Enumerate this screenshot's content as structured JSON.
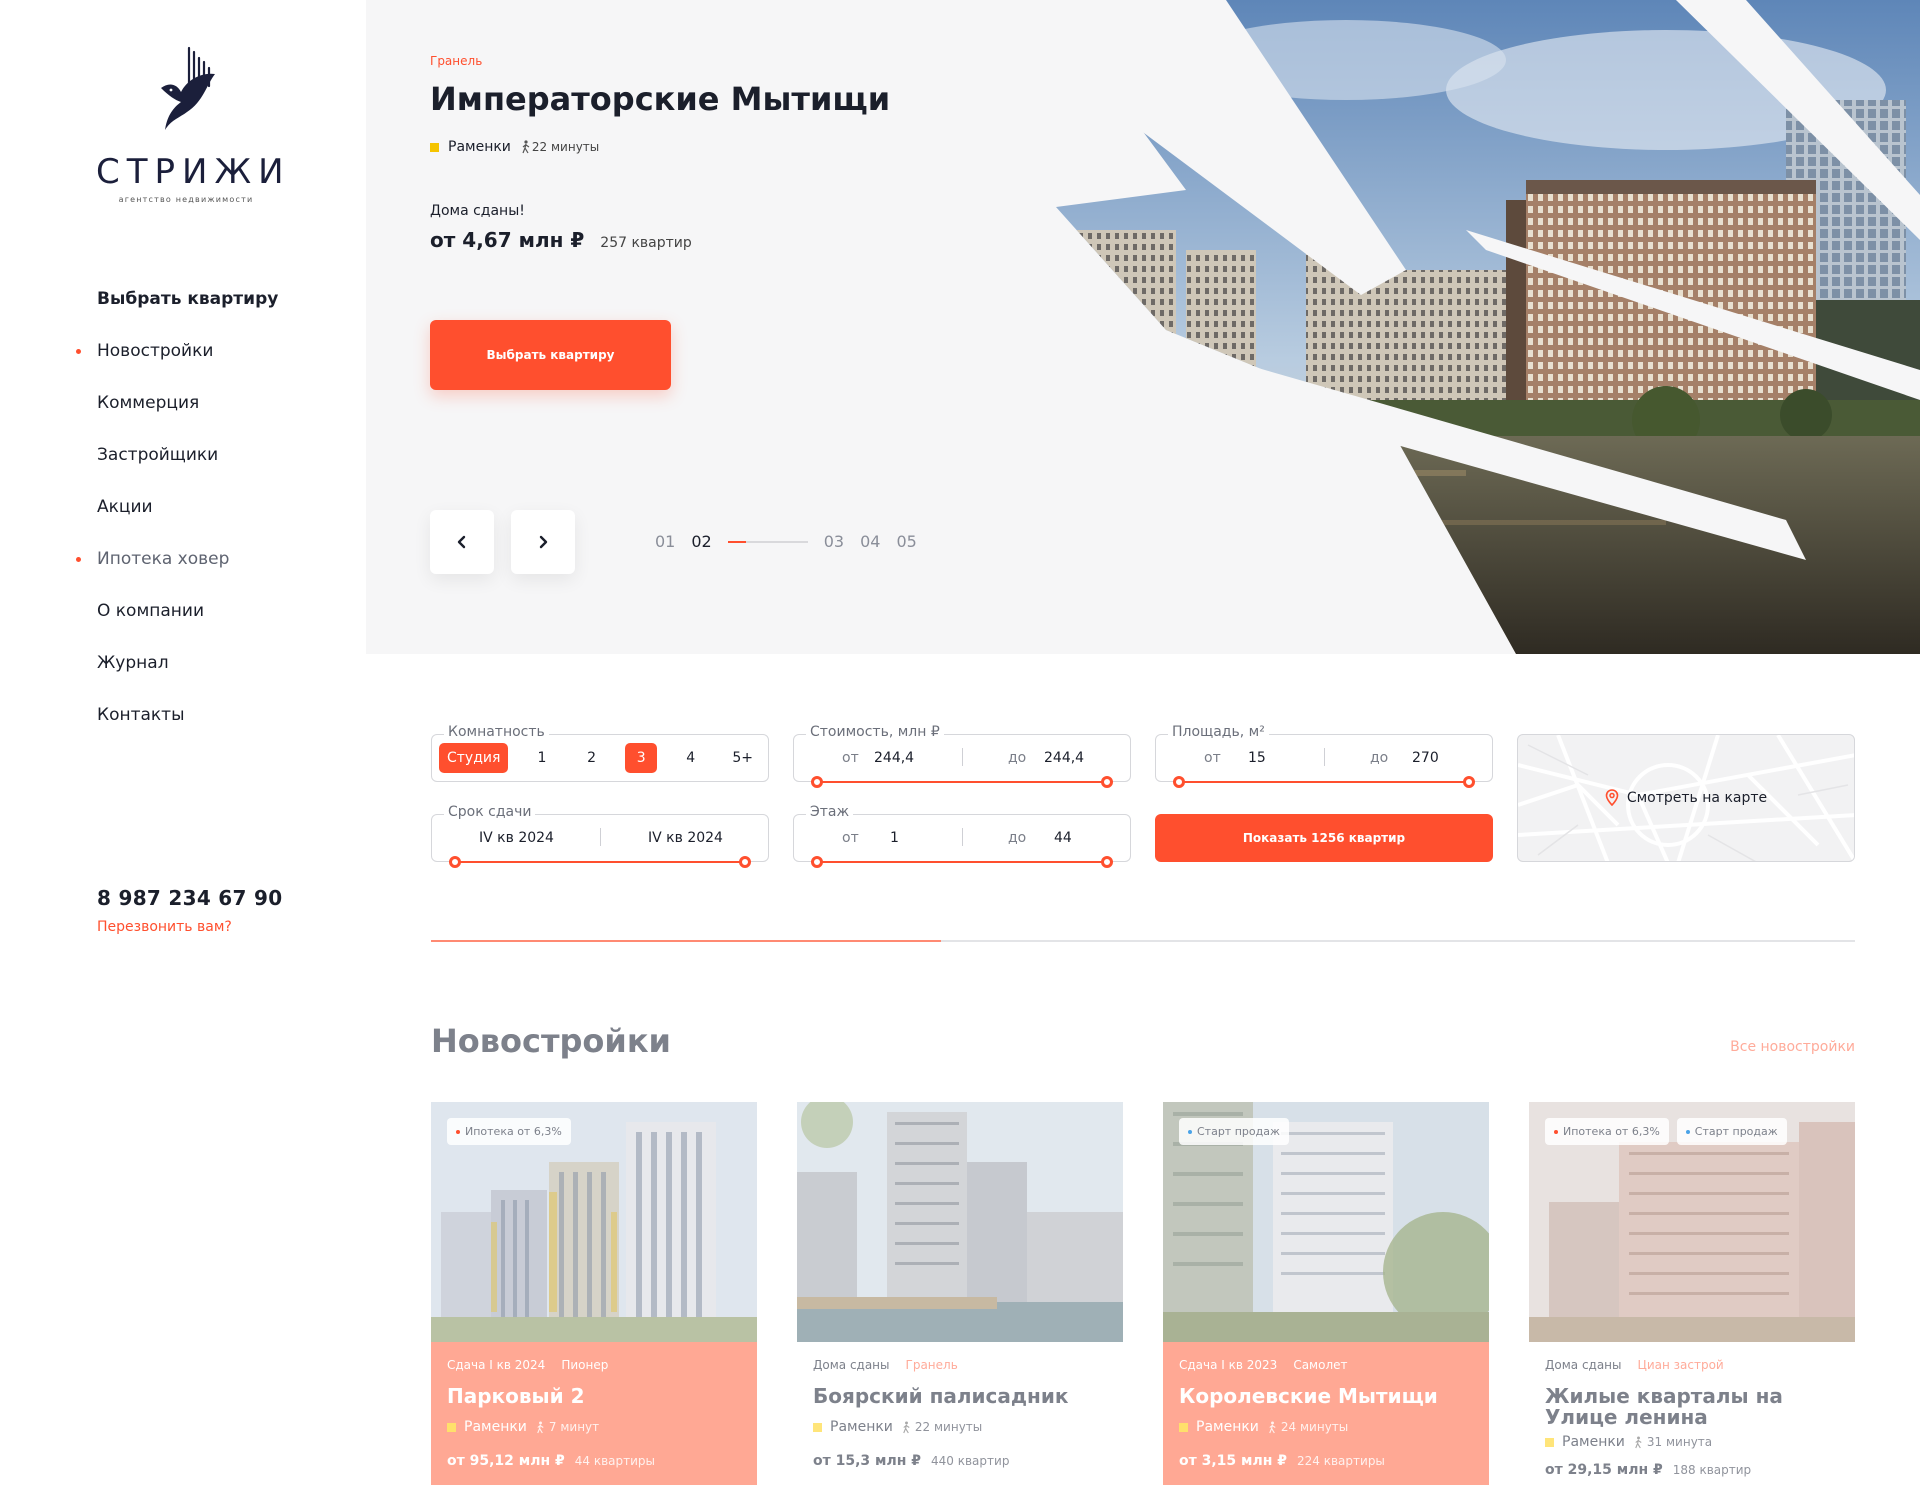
{
  "brand": {
    "name": "СТРИЖИ",
    "tagline": "агентство недвижимости"
  },
  "nav": [
    {
      "label": "Выбрать квартиру",
      "dot": false
    },
    {
      "label": "Новостройки",
      "dot": true
    },
    {
      "label": "Коммерция",
      "dot": false
    },
    {
      "label": "Застройщики",
      "dot": false
    },
    {
      "label": "Акции",
      "dot": false
    },
    {
      "label": "Ипотека ховер",
      "dot": true
    },
    {
      "label": "О компании",
      "dot": false
    },
    {
      "label": "Журнал",
      "dot": false
    },
    {
      "label": "Контакты",
      "dot": false
    }
  ],
  "contact": {
    "phone": "8 987 234 67 90",
    "callback": "Перезвонить вам?"
  },
  "hero": {
    "developer": "Гранель",
    "title": "Императорские Мытищи",
    "metro": "Раменки",
    "walk": "22 минуты",
    "status": "Дома сданы!",
    "price": "от 4,67 млн ₽",
    "count": "257 квартир",
    "cta": "Выбрать квартиру",
    "pager": {
      "p1": "01",
      "p2": "02",
      "p3": "03",
      "p4": "04",
      "p5": "05",
      "active": "02"
    }
  },
  "filters": {
    "rooms": {
      "label": "Комнатность",
      "options": [
        "Студия",
        "1",
        "2",
        "3",
        "4",
        "5+"
      ],
      "selected": [
        "Студия",
        "3"
      ]
    },
    "cost": {
      "label": "Стоимость, млн ₽",
      "from_label": "от",
      "from": "244,4",
      "to_label": "до",
      "to": "244,4"
    },
    "area": {
      "label": "Площадь, м²",
      "from_label": "от",
      "from": "15",
      "to_label": "до",
      "to": "270"
    },
    "deadline": {
      "label": "Срок сдачи",
      "from": "IV кв 2024",
      "to": "IV кв 2024"
    },
    "floor": {
      "label": "Этаж",
      "from_label": "от",
      "from": "1",
      "to_label": "до",
      "to": "44"
    },
    "show_button": "Показать 1256 квартир",
    "map_button": "Смотреть на карте"
  },
  "section": {
    "title": "Новостройки",
    "all_link": "Все новостройки",
    "cards": [
      {
        "badges": [
          "Ипотека от 6,3%"
        ],
        "deadline": "Сдача I кв 2024",
        "developer": "Пионер",
        "name": "Парковый 2",
        "metro": "Раменки",
        "walk": "7 минут",
        "price": "от 95,12 млн ₽",
        "count": "44 квартиры"
      },
      {
        "badges": [],
        "deadline": "Дома сданы",
        "developer": "Гранель",
        "name": "Боярский палисадник",
        "metro": "Раменки",
        "walk": "22 минуты",
        "price": "от 15,3 млн ₽",
        "count": "440 квартир"
      },
      {
        "badges": [
          "Старт продаж"
        ],
        "deadline": "Сдача I кв 2023",
        "developer": "Самолет",
        "name": "Королевские Мытищи",
        "metro": "Раменки",
        "walk": "24 минуты",
        "price": "от 3,15 млн ₽",
        "count": "224 квартиры"
      },
      {
        "badges": [
          "Ипотека от 6,3%",
          "Старт продаж"
        ],
        "deadline": "Дома сданы",
        "developer": "Циан застрой",
        "name": "Жилые кварталы на Улице ленина",
        "metro": "Раменки",
        "walk": "31 минута",
        "price": "от 29,15 млн ₽",
        "count": "188 квартир"
      }
    ]
  },
  "colors": {
    "accent": "#ff4f2e",
    "accent_soft": "#ffa894",
    "metro": "#f5c400",
    "text": "#1b1f2b",
    "muted": "#7d818b"
  },
  "icons": [
    "bird-logo-icon",
    "walking-person-icon",
    "chevron-left-icon",
    "chevron-right-icon",
    "map-pin-icon"
  ]
}
